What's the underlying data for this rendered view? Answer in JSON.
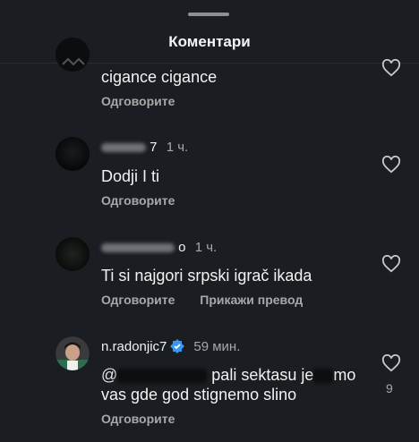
{
  "sheet": {
    "title": "Коментари"
  },
  "comments": [
    {
      "username": "",
      "time": "",
      "text": "cigance cigance",
      "actions": [
        "Одговорите"
      ],
      "likes": ""
    },
    {
      "username": "7",
      "time": "1 ч.",
      "text": "Dodji I ti",
      "actions": [
        "Одговорите"
      ],
      "likes": ""
    },
    {
      "username": "o",
      "time": "1 ч.",
      "text": "Ti si najgori srpski igrač ikada",
      "actions": [
        "Одговорите",
        "Прикажи превод"
      ],
      "likes": ""
    },
    {
      "username": "n.radonjic7",
      "time": "59 мин.",
      "text_line1_a": "@",
      "text_line1_b": "pali sektasu je",
      "text_line1_c": "mo",
      "text_line2": "vas gde god stignemo slino",
      "actions": [
        "Одговорите"
      ],
      "likes": "9"
    }
  ],
  "icons": {
    "like": "heart-outline-icon",
    "verified": "verified-badge-icon"
  },
  "colors": {
    "background": "#1a1d21",
    "verified": "#3897f0"
  }
}
